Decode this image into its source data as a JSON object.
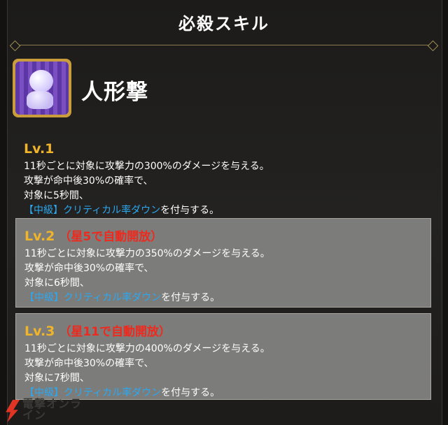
{
  "header": {
    "title": "必殺スキル"
  },
  "skill": {
    "name": "人形撃",
    "icon": "doll-skill-icon"
  },
  "levels": [
    {
      "label": "Lv.1",
      "unlock": "",
      "line1": "11秒ごとに対象に攻撃力の300%のダメージを与える。",
      "line2": "攻撃が命中後30%の確率で、",
      "line3": "対象に5秒間、",
      "tag": "【中級】",
      "status": "クリティカル率ダウン",
      "suffix": "を付与する。"
    },
    {
      "label": "Lv.2",
      "unlock": "（星5で自動開放）",
      "line1": "11秒ごとに対象に攻撃力の350%のダメージを与える。",
      "line2": "攻撃が命中後30%の確率で、",
      "line3": "対象に6秒間、",
      "tag": "【中級】",
      "status": "クリティカル率ダウン",
      "suffix": "を付与する。"
    },
    {
      "label": "Lv.3",
      "unlock": "（星11で自動開放）",
      "line1": "11秒ごとに対象に攻撃力の400%のダメージを与える。",
      "line2": "攻撃が命中後30%の確率で、",
      "line3": "対象に7秒間、",
      "tag": "【中級】",
      "status": "クリティカル率ダウン",
      "suffix": "を付与する。"
    }
  ],
  "colors": {
    "level_label": "#f0b42b",
    "unlock_text": "#ee2a1e",
    "status_text": "#2aa9f2",
    "boxed_background": "#7c7c7b"
  },
  "watermark": {
    "text": "電撃オンライン"
  }
}
